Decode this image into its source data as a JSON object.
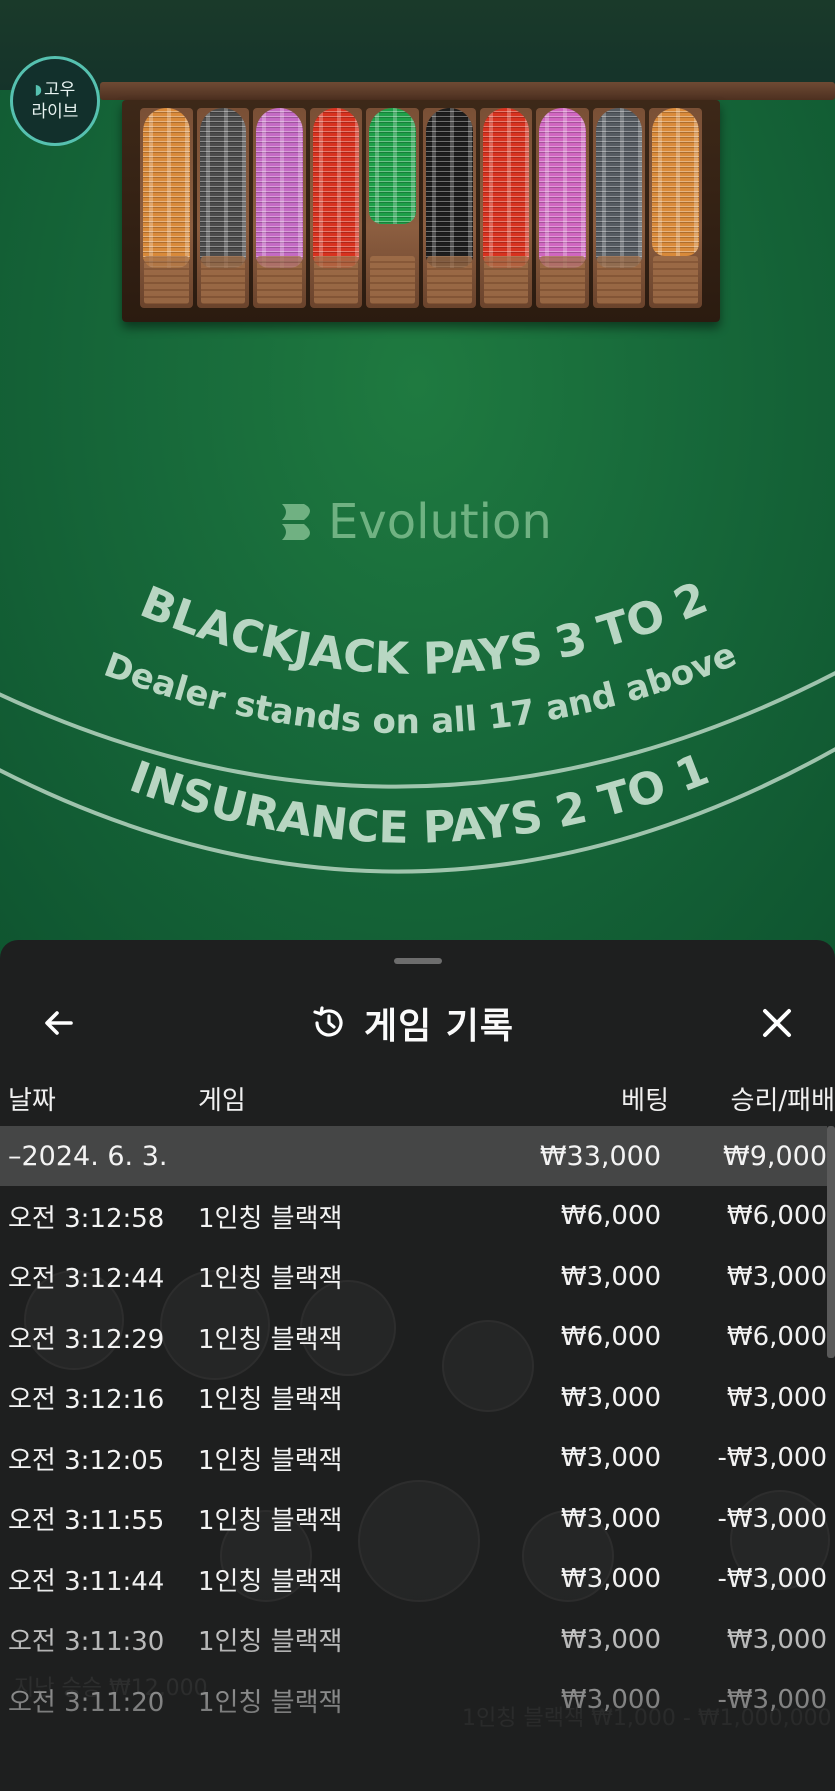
{
  "brand_badge": {
    "line1": "고우",
    "line2": "라이브"
  },
  "table": {
    "logo": "Evolution",
    "line1": "BLACKJACK PAYS 3 TO 2",
    "line2": "Dealer stands on all 17 and above",
    "line3": "INSURANCE PAYS 2 TO 1",
    "chip_colors": [
      "#d98a3a",
      "#4b4b4b",
      "#c46ac4",
      "#d8321f",
      "#1ea049",
      "#1d1d1d",
      "#d8321f",
      "#d066c0",
      "#555b61",
      "#d98a3a"
    ]
  },
  "sheet": {
    "title": "게임 기록",
    "columns": {
      "date": "날짜",
      "game": "게임",
      "bet": "베팅",
      "result": "승리/패배"
    },
    "summary": {
      "date": "–2024. 6. 3.",
      "bet": "₩33,000",
      "result": "₩9,000"
    },
    "rows": [
      {
        "time": "오전 3:12:58",
        "game": "1인칭 블랙잭",
        "bet": "₩6,000",
        "result": "₩6,000"
      },
      {
        "time": "오전 3:12:44",
        "game": "1인칭 블랙잭",
        "bet": "₩3,000",
        "result": "₩3,000"
      },
      {
        "time": "오전 3:12:29",
        "game": "1인칭 블랙잭",
        "bet": "₩6,000",
        "result": "₩6,000"
      },
      {
        "time": "오전 3:12:16",
        "game": "1인칭 블랙잭",
        "bet": "₩3,000",
        "result": "₩3,000"
      },
      {
        "time": "오전 3:12:05",
        "game": "1인칭 블랙잭",
        "bet": "₩3,000",
        "result": "-₩3,000"
      },
      {
        "time": "오전 3:11:55",
        "game": "1인칭 블랙잭",
        "bet": "₩3,000",
        "result": "-₩3,000"
      },
      {
        "time": "오전 3:11:44",
        "game": "1인칭 블랙잭",
        "bet": "₩3,000",
        "result": "-₩3,000"
      },
      {
        "time": "오전 3:11:30",
        "game": "1인칭 블랙잭",
        "bet": "₩3,000",
        "result": "₩3,000"
      },
      {
        "time": "오전 3:11:20",
        "game": "1인칭 블랙잭",
        "bet": "₩3,000",
        "result": "-₩3,000"
      }
    ],
    "background_text": {
      "left": "지난 승승 ₩12,000",
      "right": "1인칭 블랙잭 ₩1,000 - ₩1,000,000"
    }
  },
  "colors": {
    "felt": "#17693a",
    "sheet_bg": "#1e1f1f",
    "summary_bg": "#454646",
    "badge_accent": "#56c1b0"
  }
}
